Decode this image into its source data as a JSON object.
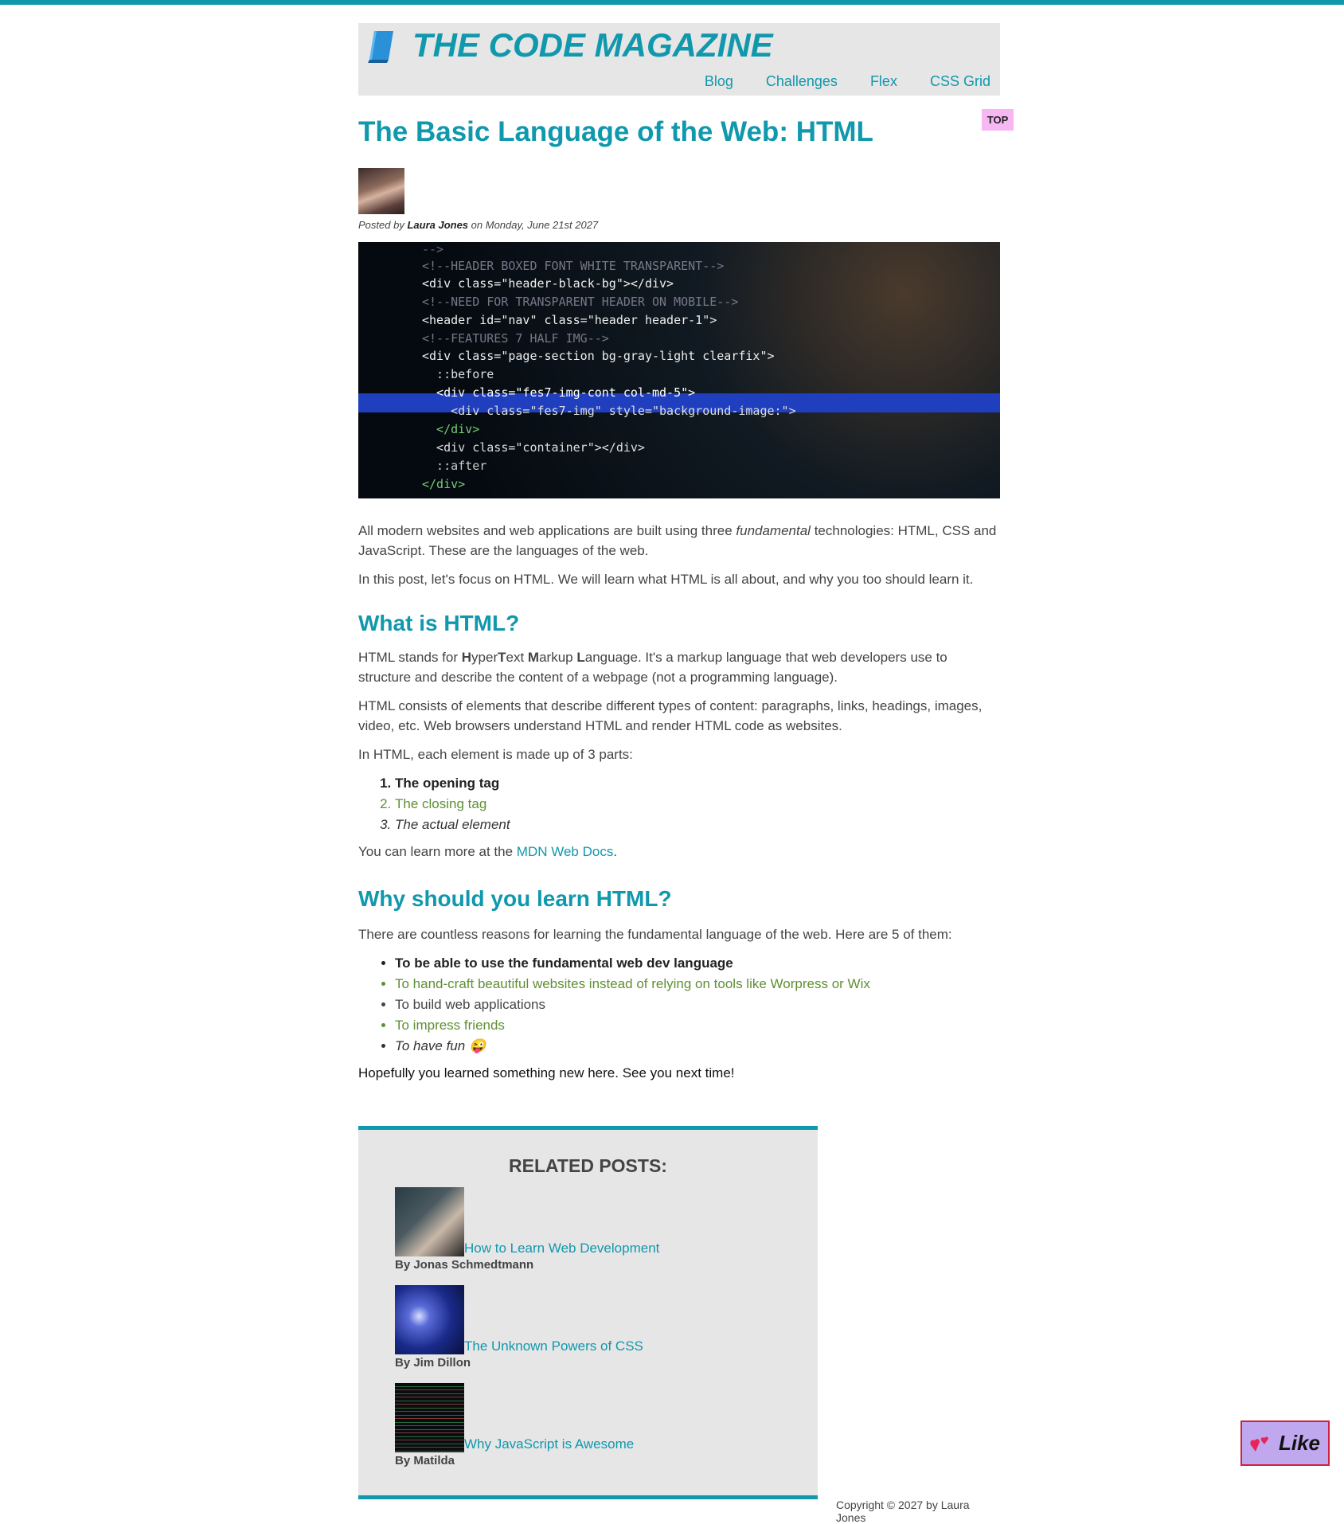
{
  "header": {
    "title": "THE CODE MAGAZINE",
    "nav": [
      "Blog",
      "Challenges",
      "Flex",
      "CSS Grid"
    ]
  },
  "top_badge": "TOP",
  "post": {
    "title": "The Basic Language of the Web: HTML",
    "posted_by_prefix": "Posted by",
    "author": "Laura Jones",
    "date_text": "on Monday, June 21st 2027",
    "hero_code": [
      "--> ",
      "<!--HEADER BOXED FONT WHITE TRANSPARENT-->",
      "<div class=\"header-black-bg\"></div>",
      "<!--NEED FOR TRANSPARENT HEADER ON MOBILE-->",
      "<header id=\"nav\" class=\"header header-1\">",
      "<!--FEATURES 7 HALF IMG-->",
      "<div class=\"page-section bg-gray-light clearfix\">",
      "  ::before",
      "  <div class=\"fes7-img-cont col-md-5\">",
      "    <div class=\"fes7-img\" style=\"background-image:\">",
      "  </div>",
      "  <div class=\"container\"></div>",
      "  ::after",
      "</div>"
    ],
    "intro_1_a": "All modern websites and web applications are built using three ",
    "intro_1_em": "fundamental",
    "intro_1_b": " technologies: HTML, CSS and JavaScript. These are the languages of the web.",
    "intro_2": "In this post, let's focus on HTML. We will learn what HTML is all about, and why you too should learn it.",
    "section1": {
      "heading": "What is HTML?",
      "p1_prefix": "HTML stands for ",
      "p1_words": [
        "H",
        "yper",
        "T",
        "ext",
        "M",
        "arkup",
        "L",
        "anguage"
      ],
      "p1_suffix": ". It's a markup language that web developers use to structure and describe the content of a webpage (not a programming language).",
      "p2": "HTML consists of elements that describe different types of content: paragraphs, links, headings, images, video, etc. Web browsers understand HTML and render HTML code as websites.",
      "p3": "In HTML, each element is made up of 3 parts:",
      "list": [
        "The opening tag",
        "The closing tag",
        "The actual element"
      ],
      "p4_prefix": "You can learn more at the ",
      "p4_link": "MDN Web Docs",
      "p4_suffix": "."
    },
    "section2": {
      "heading": "Why should you learn HTML?",
      "p1": "There are countless reasons for learning the fundamental language of the web. Here are 5 of them:",
      "list": [
        "To be able to use the fundamental web dev language",
        "To hand-craft beautiful websites instead of relying on tools like Worpress or Wix",
        "To build web applications",
        "To impress friends",
        "To have fun 😜"
      ],
      "closing": "Hopefully you learned something new here. See you next time!"
    }
  },
  "related": {
    "heading": "RELATED POSTS:",
    "posts": [
      {
        "title": "How to Learn Web Development",
        "author": "By Jonas Schmedtmann"
      },
      {
        "title": "The Unknown Powers of CSS",
        "author": "By Jim Dillon"
      },
      {
        "title": "Why JavaScript is Awesome",
        "author": "By Matilda"
      }
    ]
  },
  "footer": {
    "copyright": "Copyright © 2027 by Laura Jones"
  },
  "like_button": {
    "label": "Like"
  },
  "colors": {
    "accent": "#1098ad",
    "green": "#5f8f33",
    "like_bg": "#c0a8ee",
    "top_badge_bg": "#f6b7f2"
  }
}
